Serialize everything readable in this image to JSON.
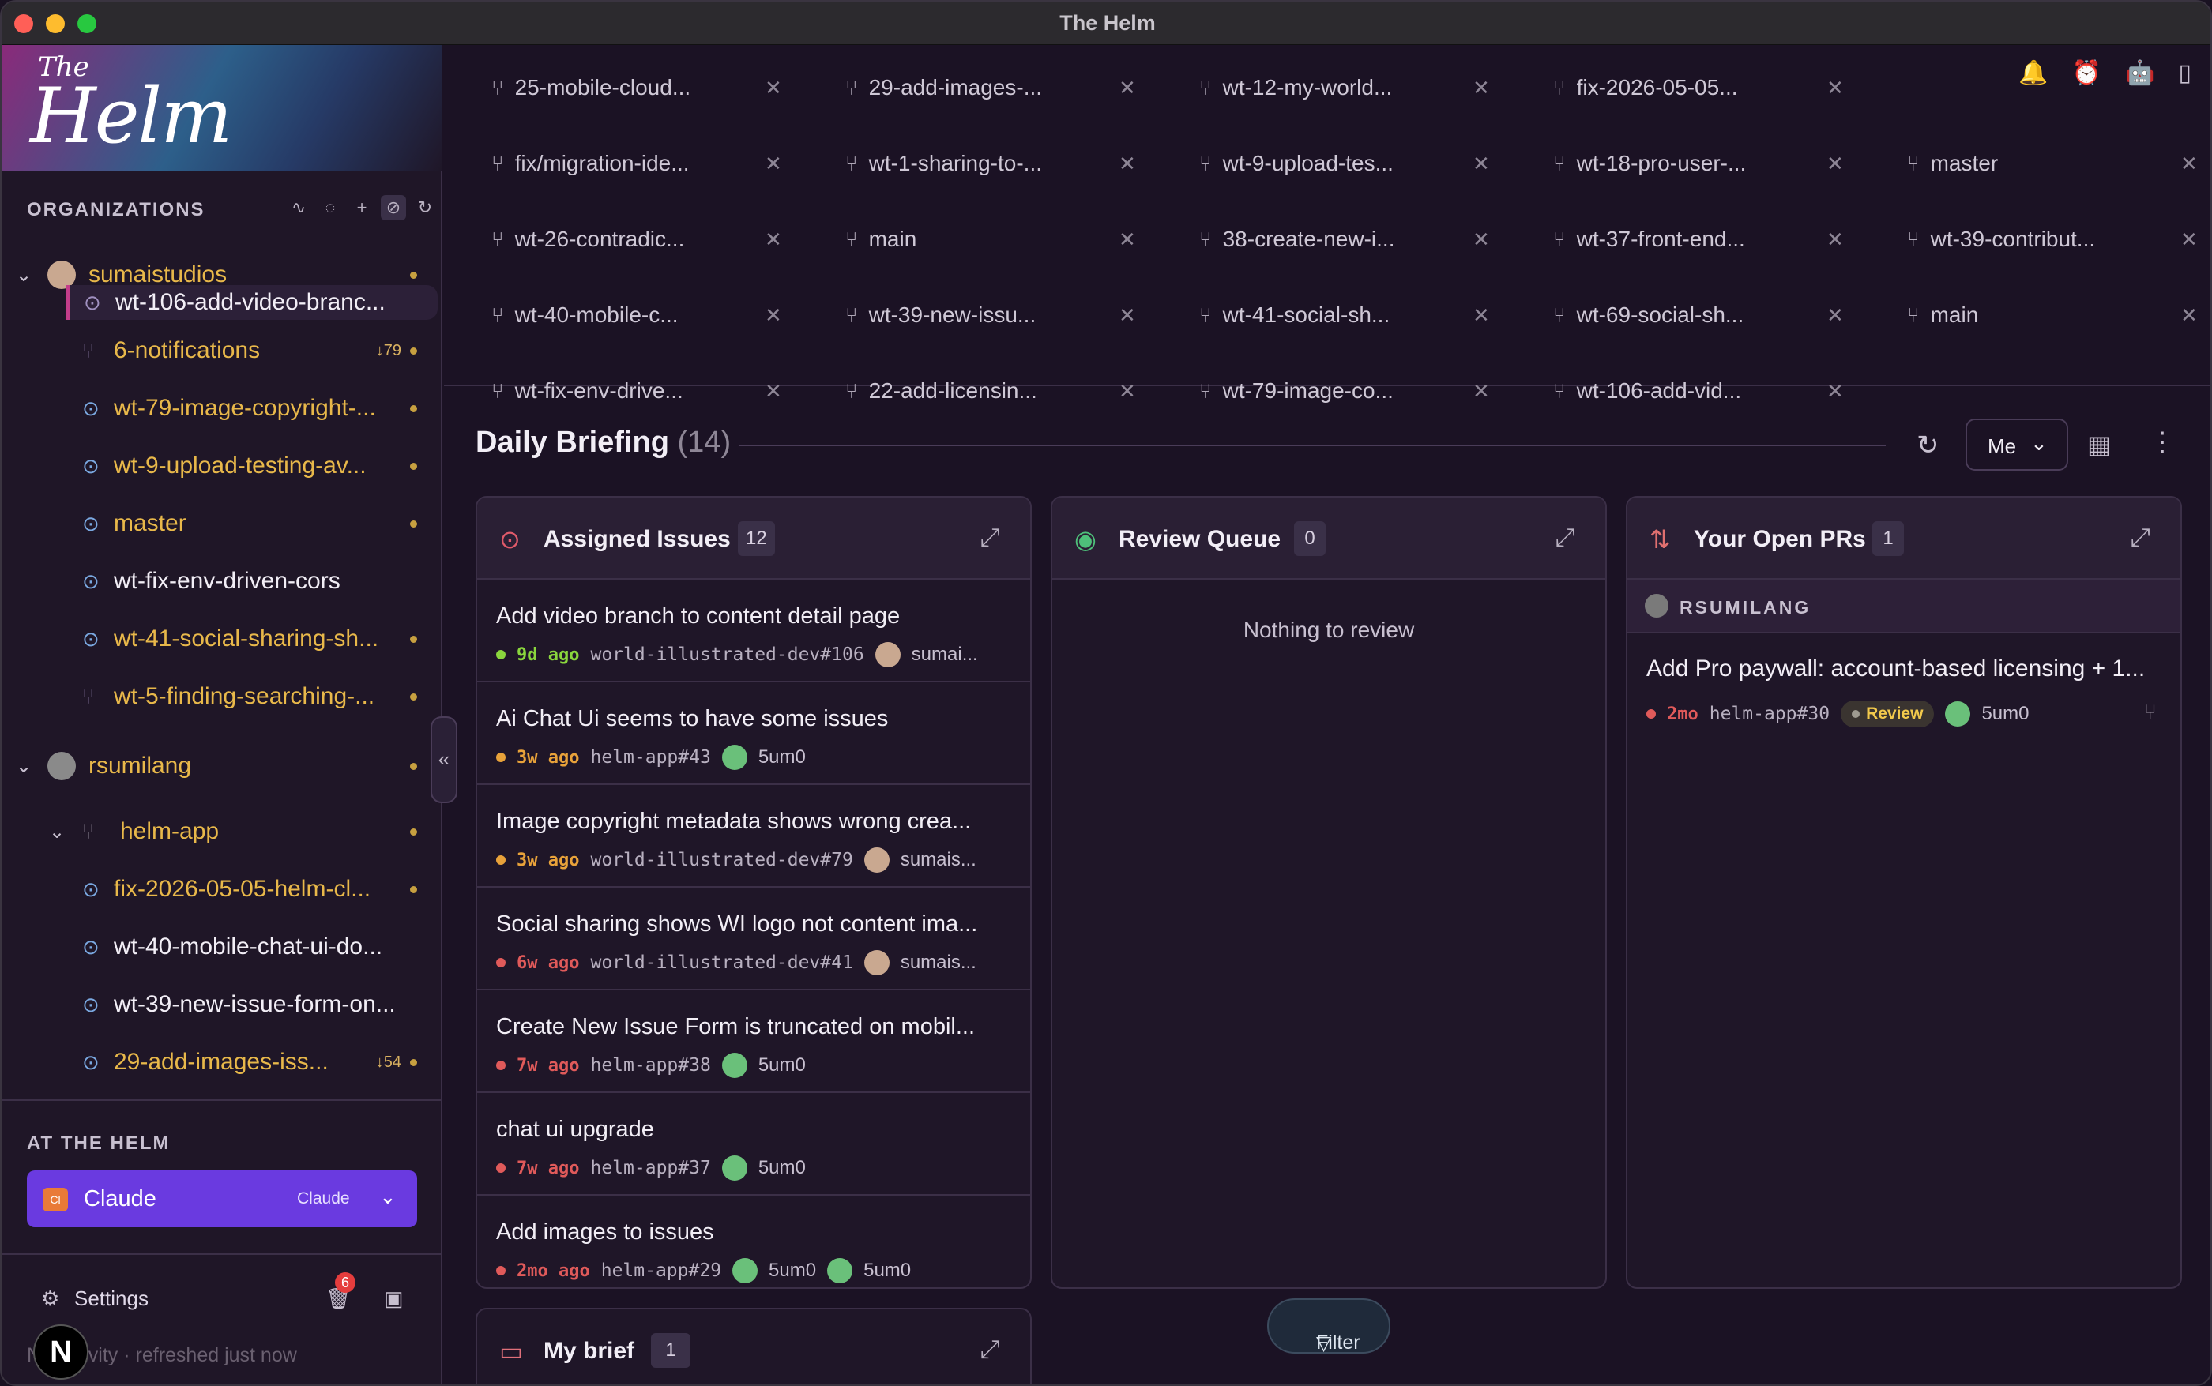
{
  "window": {
    "title": "The Helm"
  },
  "logo": {
    "the": "The",
    "helm": "Helm"
  },
  "sidebar": {
    "organizations_label": "ORGANIZATIONS",
    "orgs": [
      {
        "name": "sumaistudios"
      },
      {
        "name": "rsumilang"
      }
    ],
    "items": [
      {
        "label": "wt-106-add-video-branc...",
        "icon": "issue-icon",
        "tone": "white"
      },
      {
        "label": "6-notifications",
        "icon": "branch-icon",
        "tone": "gold",
        "count": "↓79"
      },
      {
        "label": "wt-79-image-copyright-...",
        "icon": "issue-icon",
        "tone": "gold"
      },
      {
        "label": "wt-9-upload-testing-av...",
        "icon": "issue-icon",
        "tone": "gold"
      },
      {
        "label": "master",
        "icon": "issue-icon",
        "tone": "gold"
      },
      {
        "label": "wt-fix-env-driven-cors",
        "icon": "issue-icon",
        "tone": "white"
      },
      {
        "label": "wt-41-social-sharing-sh...",
        "icon": "issue-icon",
        "tone": "gold"
      },
      {
        "label": "wt-5-finding-searching-...",
        "icon": "branch-icon",
        "tone": "gold"
      }
    ],
    "repo": {
      "name": "helm-app"
    },
    "repo_items": [
      {
        "label": "fix-2026-05-05-helm-cl...",
        "icon": "issue-icon",
        "tone": "gold"
      },
      {
        "label": "wt-40-mobile-chat-ui-do...",
        "icon": "issue-icon",
        "tone": "white"
      },
      {
        "label": "wt-39-new-issue-form-on...",
        "icon": "issue-icon",
        "tone": "white"
      },
      {
        "label": "29-add-images-iss...",
        "icon": "issue-icon",
        "tone": "gold",
        "count": "↓54"
      }
    ],
    "at_the_helm_label": "AT THE HELM",
    "agent": {
      "badge": "Cl",
      "name": "Claude",
      "tag": "Claude"
    },
    "settings_label": "Settings",
    "trash_badge": "6",
    "status": "No activity · refreshed just now",
    "user_initial": "N"
  },
  "tabs": [
    [
      "25-mobile-cloud...",
      "29-add-images-...",
      "wt-12-my-world...",
      "fix-2026-05-05..."
    ],
    [
      "fix/migration-ide...",
      "wt-1-sharing-to-...",
      "wt-9-upload-tes...",
      "wt-18-pro-user-...",
      "master"
    ],
    [
      "wt-26-contradic...",
      "main",
      "38-create-new-i...",
      "wt-37-front-end...",
      "wt-39-contribut..."
    ],
    [
      "wt-40-mobile-c...",
      "wt-39-new-issu...",
      "wt-41-social-sh...",
      "wt-69-social-sh...",
      "main"
    ],
    [
      "wt-fix-env-drive...",
      "22-add-licensin...",
      "wt-79-image-co...",
      "wt-106-add-vid..."
    ]
  ],
  "briefing": {
    "title": "Daily Briefing",
    "count": "(14)",
    "scope": "Me"
  },
  "assigned": {
    "title": "Assigned Issues",
    "count": "12",
    "issues": [
      {
        "title": "Add video branch to content detail page",
        "age": "9d ago",
        "repo": "world-illustrated-dev#106",
        "users": [
          "sumai..."
        ],
        "status": "green"
      },
      {
        "title": "Ai Chat Ui seems to have some issues",
        "age": "3w ago",
        "repo": "helm-app#43",
        "users": [
          "5um0"
        ],
        "status": "orange"
      },
      {
        "title": "Image copyright metadata shows wrong crea...",
        "age": "3w ago",
        "repo": "world-illustrated-dev#79",
        "users": [
          "sumais..."
        ],
        "status": "orange"
      },
      {
        "title": "Social sharing shows WI logo not content ima...",
        "age": "6w ago",
        "repo": "world-illustrated-dev#41",
        "users": [
          "sumais..."
        ],
        "status": "red"
      },
      {
        "title": "Create New Issue Form is truncated on mobil...",
        "age": "7w ago",
        "repo": "helm-app#38",
        "users": [
          "5um0"
        ],
        "status": "red"
      },
      {
        "title": "chat ui upgrade",
        "age": "7w ago",
        "repo": "helm-app#37",
        "users": [
          "5um0"
        ],
        "status": "red"
      },
      {
        "title": "Add images to issues",
        "age": "2mo ago",
        "repo": "helm-app#29",
        "users": [
          "5um0",
          "5um0"
        ],
        "status": "red"
      }
    ]
  },
  "review": {
    "title": "Review Queue",
    "count": "0",
    "empty": "Nothing to review"
  },
  "prs": {
    "title": "Your Open PRs",
    "count": "1",
    "org": "RSUMILANG",
    "items": [
      {
        "title": "Add Pro paywall: account-based licensing + 1...",
        "age": "2mo",
        "repo": "helm-app#30",
        "state": "Review",
        "user": "5um0"
      }
    ]
  },
  "mybrief": {
    "title": "My brief",
    "count": "1"
  },
  "filter_label": "Filter",
  "colors": {
    "green": "#8ad63d",
    "orange": "#e8a23a",
    "red": "#e05a5a",
    "gold": "#e8b84a",
    "accent": "#6a3ae0"
  }
}
